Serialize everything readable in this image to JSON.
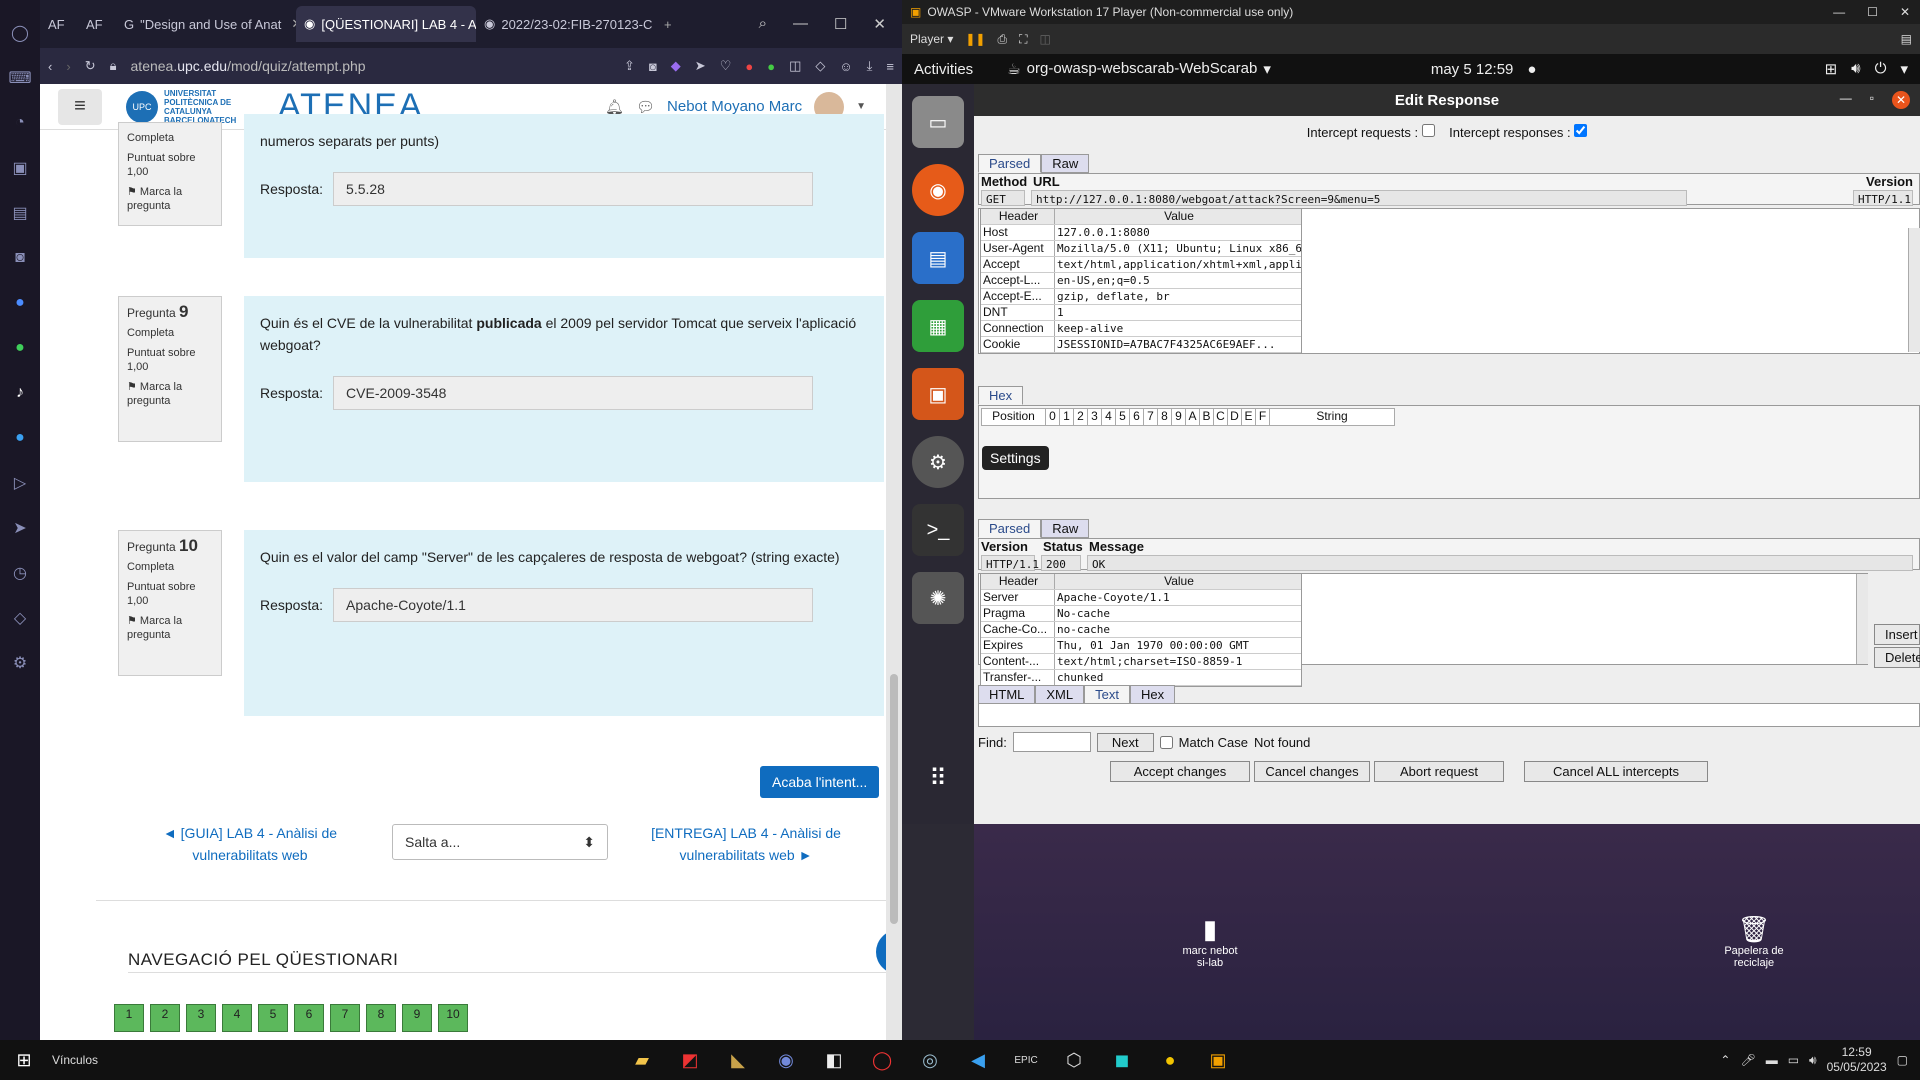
{
  "browser": {
    "tabs": [
      {
        "label": "AF",
        "active": false
      },
      {
        "label": "AF",
        "active": false
      },
      {
        "label": "\"Design and Use of Anat",
        "active": false
      },
      {
        "label": "[QÜESTIONARI] LAB 4 - A",
        "active": true
      },
      {
        "label": "2022/23-02:FIB-270123-C",
        "active": false
      }
    ],
    "url_domain": "atenea.",
    "url_host": "upc.edu",
    "url_path": "/mod/quiz/attempt.php"
  },
  "moodle": {
    "logo_seal": "UPC",
    "university_name": "UNIVERSITAT POLITÈCNICA DE CATALUNYA BARCELONATECH",
    "brand": "ATENEA",
    "user_name": "Nebot Moyano Marc"
  },
  "quiz": {
    "q8": {
      "status": "Completa",
      "score": "Puntuat sobre 1,00",
      "flag": "Marca la pregunta",
      "question_tail": "numeros separats per punts)",
      "answer_label": "Resposta:",
      "answer": "5.5.28"
    },
    "q9": {
      "pregunta": "Pregunta",
      "number": "9",
      "status": "Completa",
      "score": "Puntuat sobre 1,00",
      "flag": "Marca la pregunta",
      "question_a": "Quin és el CVE de la vulnerabilitat ",
      "question_bold": "publicada",
      "question_b": " el 2009 pel servidor Tomcat que serveix l'aplicació webgoat?",
      "answer_label": "Resposta:",
      "answer": "CVE-2009-3548"
    },
    "q10": {
      "pregunta": "Pregunta",
      "number": "10",
      "status": "Completa",
      "score": "Puntuat sobre 1,00",
      "flag": "Marca la pregunta",
      "question": "Quin es el valor del camp \"Server\" de les capçaleres de resposta de webgoat? (string exacte)",
      "answer_label": "Resposta:",
      "answer": "Apache-Coyote/1.1"
    },
    "finish_button": "Acaba l'intent...",
    "prev_link": "◄ [GUIA] LAB 4 - Anàlisi de vulnerabilitats web",
    "jump_select": "Salta a...",
    "next_link": "[ENTREGA] LAB 4 - Anàlisi de vulnerabilitats web ►",
    "nav_title": "NAVEGACIÓ PEL QÜESTIONARI",
    "nav_buttons": [
      "1",
      "2",
      "3",
      "4",
      "5",
      "6",
      "7",
      "8",
      "9",
      "10"
    ]
  },
  "vm": {
    "title": "OWASP - VMware Workstation 17 Player (Non-commercial use only)",
    "player_menu": "Player",
    "activities": "Activities",
    "app_name": "org-owasp-webscarab-WebScarab",
    "clock": "may 5  12:59"
  },
  "webscarab": {
    "title": "Edit Response",
    "intercept_requests": "Intercept requests :",
    "intercept_responses": "Intercept responses :",
    "intercept_requests_checked": false,
    "intercept_responses_checked": true,
    "tab_parsed": "Parsed",
    "tab_raw": "Raw",
    "req_col_method": "Method",
    "req_col_url": "URL",
    "req_col_version": "Version",
    "req_method": "GET",
    "req_url": "http://127.0.0.1:8080/webgoat/attack?Screen=9&menu=5",
    "req_version": "HTTP/1.1",
    "col_header": "Header",
    "col_value": "Value",
    "req_headers": [
      {
        "k": "Host",
        "v": "127.0.0.1:8080"
      },
      {
        "k": "User-Agent",
        "v": "Mozilla/5.0 (X11; Ubuntu; Linux x86_6..."
      },
      {
        "k": "Accept",
        "v": "text/html,application/xhtml+xml,appli..."
      },
      {
        "k": "Accept-L...",
        "v": "en-US,en;q=0.5"
      },
      {
        "k": "Accept-E...",
        "v": "gzip, deflate, br"
      },
      {
        "k": "DNT",
        "v": "1"
      },
      {
        "k": "Connection",
        "v": "keep-alive"
      },
      {
        "k": "Cookie",
        "v": "JSESSIONID=A7BAC7F4325AC6E9AEF..."
      }
    ],
    "hex_tab": "Hex",
    "hex_position": "Position",
    "hex_cols": [
      "0",
      "1",
      "2",
      "3",
      "4",
      "5",
      "6",
      "7",
      "8",
      "9",
      "A",
      "B",
      "C",
      "D",
      "E",
      "F"
    ],
    "hex_string": "String",
    "tooltip": "Settings",
    "resp_col_version": "Version",
    "resp_col_status": "Status",
    "resp_col_message": "Message",
    "resp_version": "HTTP/1.1",
    "resp_status": "200",
    "resp_message": "OK",
    "resp_headers": [
      {
        "k": "Server",
        "v": "Apache-Coyote/1.1"
      },
      {
        "k": "Pragma",
        "v": "No-cache"
      },
      {
        "k": "Cache-Co...",
        "v": "no-cache"
      },
      {
        "k": "Expires",
        "v": "Thu, 01 Jan 1970 00:00:00 GMT"
      },
      {
        "k": "Content-...",
        "v": "text/html;charset=ISO-8859-1"
      },
      {
        "k": "Transfer-...",
        "v": "chunked"
      }
    ],
    "insert": "Insert",
    "delete": "Delete",
    "body_tabs": [
      "HTML",
      "XML",
      "Text",
      "Hex"
    ],
    "find_label": "Find:",
    "next_button": "Next",
    "match_case": "Match Case",
    "not_found": "Not found",
    "accept": "Accept changes",
    "cancel": "Cancel changes",
    "abort": "Abort request",
    "cancel_all": "Cancel ALL intercepts"
  },
  "desktop": {
    "folder_label_1": "marc nebot",
    "folder_label_2": "si-lab",
    "trash_label_1": "Papelera de",
    "trash_label_2": "reciclaje"
  },
  "taskbar": {
    "links": "Vínculos",
    "time": "12:59",
    "date": "05/05/2023"
  }
}
